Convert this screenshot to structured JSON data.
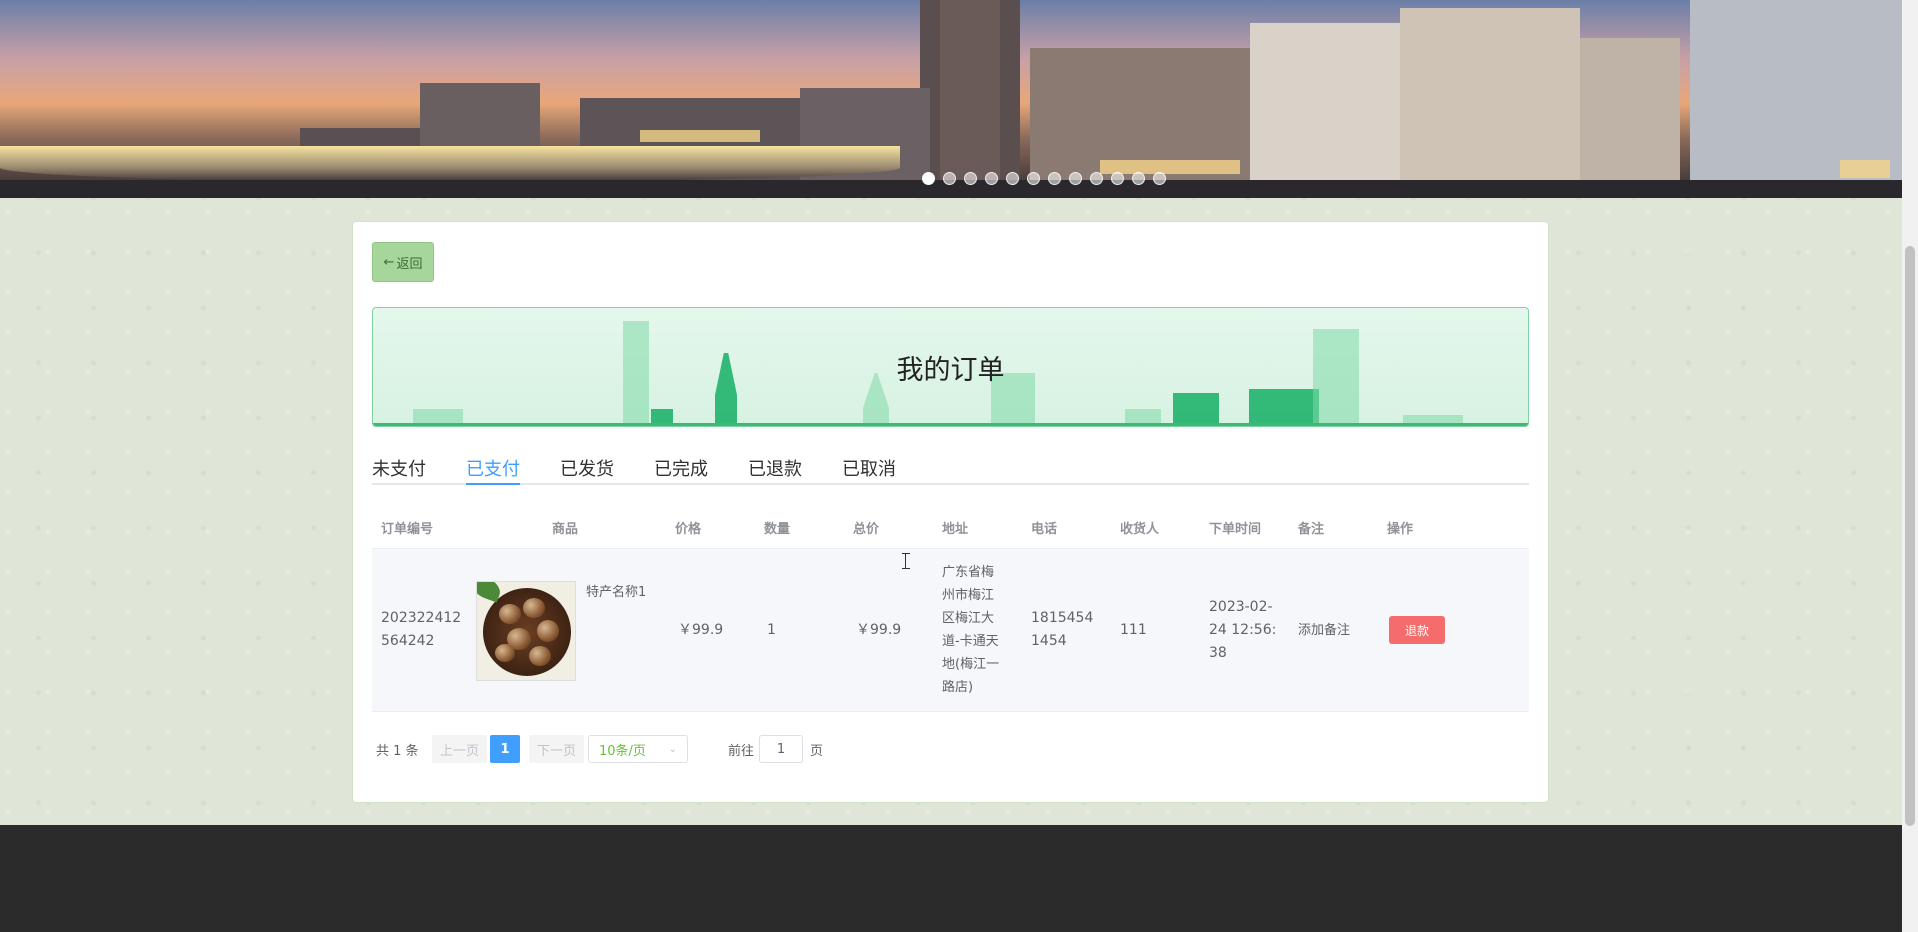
{
  "back_button": {
    "arrow": "←",
    "label": "返回"
  },
  "title": "我的订单",
  "tabs": [
    {
      "label": "未支付"
    },
    {
      "label": "已支付"
    },
    {
      "label": "已发货"
    },
    {
      "label": "已完成"
    },
    {
      "label": "已退款"
    },
    {
      "label": "已取消"
    }
  ],
  "active_tab": 1,
  "table": {
    "headers": [
      "订单编号",
      "商品",
      "价格",
      "数量",
      "总价",
      "地址",
      "电话",
      "收货人",
      "下单时间",
      "备注",
      "操作"
    ],
    "rows": [
      {
        "order_no": "202322412564242",
        "product_name": "特产名称1",
        "price": "￥99.9",
        "quantity": "1",
        "total": "￥99.9",
        "address": "广东省梅州市梅江区梅江大道-卡通天地(梅江一路店)",
        "phone": "18154541454",
        "receiver": "111",
        "order_time": "2023-02-24 12:56:38",
        "note": "添加备注",
        "action": "退款"
      }
    ]
  },
  "pagination": {
    "total_text": "共 1 条",
    "prev": "上一页",
    "current_page": "1",
    "next": "下一页",
    "page_size": "10条/页",
    "goto_label": "前往",
    "goto_value": "1",
    "page_suffix": "页"
  },
  "colors": {
    "accent": "#409eff",
    "danger": "#f56c6c",
    "back_button": "#a7d69a",
    "title_panel": "#d7f2e2"
  },
  "banner": {
    "slides": 12,
    "active_slide": 0
  }
}
